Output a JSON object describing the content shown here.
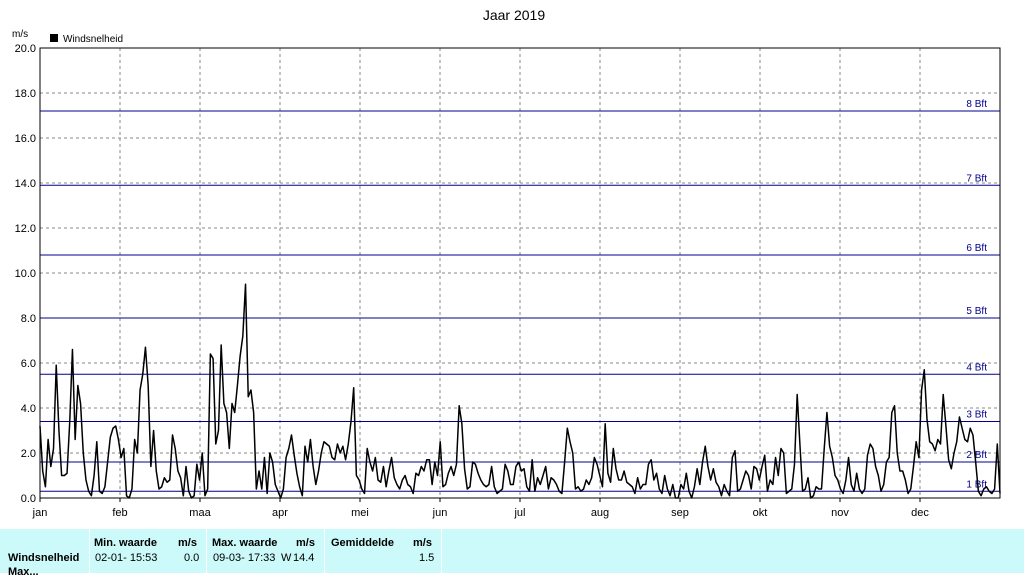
{
  "chart_data": {
    "type": "line",
    "title": "Jaar 2019",
    "ylabel": "m/s",
    "ylim": [
      0,
      20
    ],
    "y_ticks": [
      "0.0",
      "2.0",
      "4.0",
      "6.0",
      "8.0",
      "10.0",
      "12.0",
      "14.0",
      "16.0",
      "18.0",
      "20.0"
    ],
    "x_categories": [
      "jan",
      "feb",
      "maa",
      "apr",
      "mei",
      "jun",
      "jul",
      "aug",
      "sep",
      "okt",
      "nov",
      "dec"
    ],
    "grid": true,
    "legend": "top-left",
    "series": [
      {
        "name": "Windsnelheid",
        "color": "#000000",
        "values": [
          3.2,
          1.2,
          0.5,
          2.6,
          1.4,
          2.2,
          5.9,
          3.0,
          1.0,
          1.0,
          1.1,
          3.4,
          6.6,
          2.6,
          5.0,
          4.2,
          2.0,
          0.8,
          0.3,
          0.1,
          1.0,
          2.5,
          0.3,
          0.2,
          0.5,
          1.6,
          2.7,
          3.1,
          3.2,
          2.6,
          1.8,
          2.2,
          0.1,
          0.0,
          0.4,
          2.6,
          2.0,
          4.8,
          5.5,
          6.7,
          5.0,
          1.4,
          3.0,
          1.2,
          0.4,
          0.5,
          0.9,
          0.7,
          0.8,
          2.8,
          2.2,
          1.2,
          0.9,
          0.1,
          1.4,
          0.3,
          0.0,
          0.1,
          1.5,
          0.8,
          2.0,
          0.1,
          0.4,
          6.4,
          6.2,
          2.4,
          3.0,
          6.8,
          4.2,
          3.8,
          2.2,
          4.2,
          3.8,
          5.0,
          6.3,
          7.2,
          9.5,
          4.5,
          4.8,
          3.8,
          0.4,
          1.2,
          0.4,
          1.8,
          0.2,
          2.0,
          1.6,
          0.6,
          0.3,
          0.0,
          0.4,
          1.8,
          2.2,
          2.8,
          1.9,
          1.1,
          0.5,
          0.1,
          2.3,
          1.6,
          2.6,
          1.4,
          0.6,
          1.2,
          2.0,
          2.5,
          2.4,
          2.3,
          1.8,
          1.7,
          2.4,
          2.0,
          2.3,
          1.7,
          2.4,
          3.4,
          4.9,
          1.0,
          0.8,
          0.4,
          0.2,
          2.2,
          1.6,
          1.2,
          1.8,
          0.8,
          0.7,
          1.4,
          0.5,
          1.2,
          1.8,
          0.9,
          0.6,
          0.4,
          0.8,
          1.0,
          0.6,
          0.5,
          0.2,
          1.1,
          1.0,
          1.4,
          1.2,
          1.7,
          1.7,
          0.6,
          1.6,
          1.0,
          2.5,
          0.5,
          0.6,
          1.1,
          1.4,
          1.0,
          1.5,
          4.1,
          3.3,
          1.3,
          0.4,
          0.5,
          1.6,
          1.5,
          1.1,
          0.8,
          0.6,
          0.5,
          0.6,
          1.4,
          0.5,
          0.2,
          0.3,
          0.4,
          1.5,
          1.2,
          0.6,
          0.6,
          1.4,
          1.6,
          1.2,
          1.3,
          0.5,
          0.3,
          1.7,
          0.3,
          0.9,
          0.6,
          1.0,
          1.4,
          0.4,
          0.9,
          0.8,
          0.6,
          0.3,
          0.2,
          1.6,
          3.1,
          2.5,
          2.0,
          0.4,
          0.5,
          0.3,
          0.4,
          0.8,
          0.6,
          0.9,
          1.8,
          1.5,
          1.0,
          0.5,
          3.3,
          1.1,
          0.7,
          2.2,
          1.3,
          0.8,
          0.8,
          1.2,
          0.7,
          0.6,
          0.5,
          0.2,
          0.9,
          0.4,
          0.6,
          0.6,
          1.5,
          1.7,
          0.8,
          1.1,
          0.4,
          0.2,
          1.0,
          0.4,
          0.1,
          0.6,
          0.0,
          0.0,
          0.6,
          0.4,
          1.1,
          0.3,
          0.0,
          0.5,
          1.3,
          0.6,
          1.6,
          2.3,
          1.4,
          0.8,
          1.3,
          0.7,
          0.5,
          0.1,
          0.6,
          0.3,
          0.1,
          1.8,
          2.1,
          0.3,
          0.4,
          0.8,
          1.2,
          1.0,
          0.4,
          1.4,
          1.3,
          0.8,
          1.4,
          1.9,
          0.3,
          0.8,
          0.6,
          1.8,
          1.0,
          2.2,
          2.0,
          0.2,
          0.3,
          0.4,
          1.5,
          4.6,
          2.4,
          0.3,
          0.4,
          0.9,
          0.0,
          0.1,
          0.5,
          0.4,
          0.4,
          2.2,
          3.8,
          2.3,
          1.8,
          1.0,
          0.8,
          0.4,
          0.2,
          0.8,
          1.8,
          0.6,
          0.3,
          1.1,
          0.4,
          0.2,
          0.4,
          1.9,
          2.4,
          2.2,
          1.4,
          1.0,
          0.3,
          0.6,
          1.6,
          1.8,
          3.8,
          4.1,
          2.0,
          1.2,
          1.2,
          0.8,
          0.2,
          0.4,
          1.4,
          2.5,
          1.8,
          4.8,
          5.7,
          3.5,
          2.5,
          2.4,
          2.1,
          2.6,
          2.4,
          4.6,
          3.2,
          1.7,
          1.3,
          2.0,
          2.5,
          3.6,
          3.1,
          2.6,
          2.5,
          3.1,
          2.8,
          1.6,
          0.3,
          0.1,
          0.4,
          0.5,
          0.3,
          0.2,
          0.4,
          2.4,
          0.2
        ]
      }
    ],
    "beaufort_lines": [
      {
        "label": "1 Bft",
        "value": 0.3
      },
      {
        "label": "2 Bft",
        "value": 1.6
      },
      {
        "label": "3 Bft",
        "value": 3.4
      },
      {
        "label": "4 Bft",
        "value": 5.5
      },
      {
        "label": "5 Bft",
        "value": 8.0
      },
      {
        "label": "6 Bft",
        "value": 10.8
      },
      {
        "label": "7 Bft",
        "value": 13.9
      },
      {
        "label": "8 Bft",
        "value": 17.2
      }
    ],
    "line_color": "#00008b"
  },
  "stats": {
    "row_label": "Windsnelheid",
    "row_label_2": "Max...",
    "min_header": "Min. waarde",
    "max_header": "Max. waarde",
    "avg_header": "Gemiddelde",
    "unit_header": "m/s",
    "min_time": "02-01-  15:53",
    "min_value": "0.0",
    "max_time": "09-03-  17:33",
    "max_dir": "W",
    "max_value": "14.4",
    "avg_value": "1.5"
  }
}
